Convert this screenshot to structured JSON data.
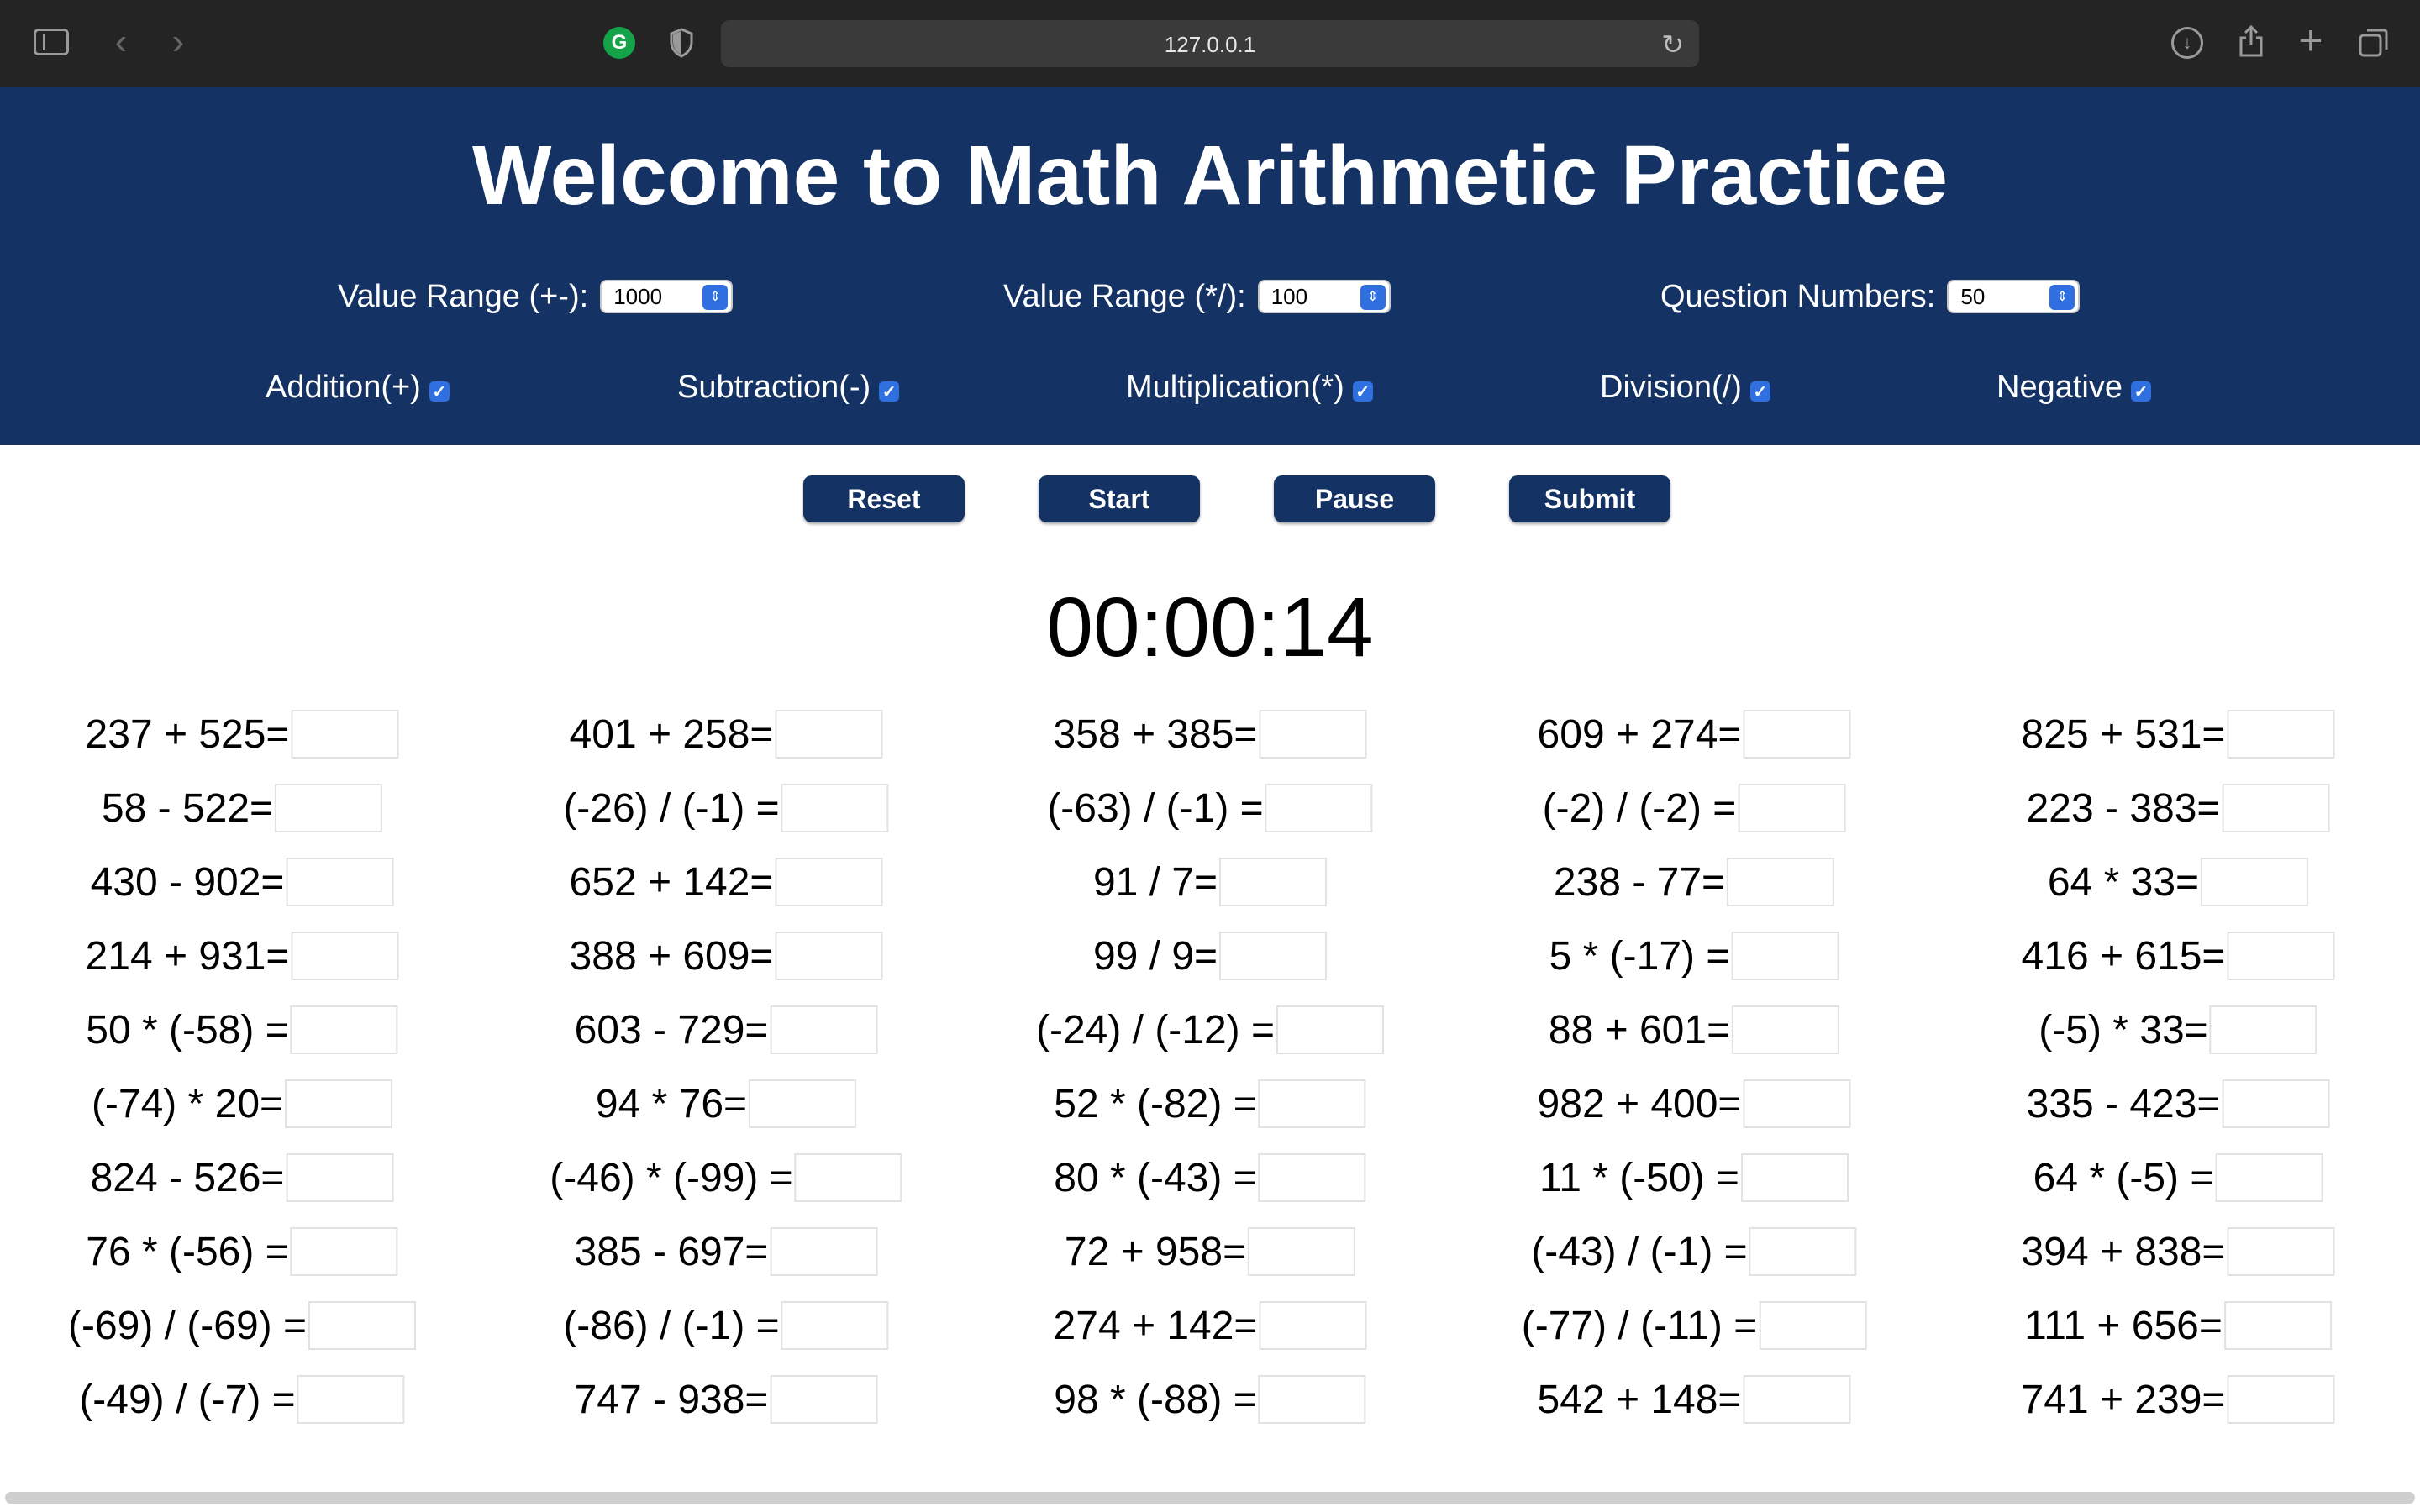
{
  "browser": {
    "url": "127.0.0.1",
    "icons": [
      "sidebar-toggle-icon",
      "back-arrow-icon",
      "forward-arrow-icon",
      "grammarly-icon",
      "privacy-shield-icon",
      "reload-icon",
      "download-icon",
      "share-icon",
      "new-tab-plus-icon",
      "tab-overview-icon"
    ],
    "grammarly_letter": "G"
  },
  "header": {
    "title": "Welcome to Math Arithmetic Practice",
    "range_add_label": "Value Range (+-):",
    "range_add_value": "1000",
    "range_mul_label": "Value Range (*/):",
    "range_mul_value": "100",
    "question_count_label": "Question Numbers:",
    "question_count_value": "50",
    "operations": [
      {
        "label": "Addition(+)",
        "checked": true
      },
      {
        "label": "Subtraction(-)",
        "checked": true
      },
      {
        "label": "Multiplication(*)",
        "checked": true
      },
      {
        "label": "Division(/)",
        "checked": true
      },
      {
        "label": "Negative",
        "checked": true
      }
    ]
  },
  "controls": {
    "reset": "Reset",
    "start": "Start",
    "pause": "Pause",
    "submit": "Submit"
  },
  "timer": "00:00:14",
  "colors": {
    "header_bg": "#143263",
    "button_bg": "#143263",
    "checkbox": "#2f6fe0"
  },
  "questions": [
    [
      "237 + 525=",
      "58 - 522=",
      "430 - 902=",
      "214 + 931=",
      "50 * (-58) =",
      "(-74) * 20=",
      "824 - 526=",
      "76 * (-56) =",
      "(-69) / (-69) =",
      "(-49) / (-7) ="
    ],
    [
      "401 + 258=",
      "(-26) / (-1) =",
      "652 + 142=",
      "388 + 609=",
      "603 - 729=",
      "94 * 76=",
      "(-46) * (-99) =",
      "385 - 697=",
      "(-86) / (-1) =",
      "747 - 938="
    ],
    [
      "358 + 385=",
      "(-63) / (-1) =",
      "91 / 7=",
      "99 / 9=",
      "(-24) / (-12) =",
      "52 * (-82) =",
      "80 * (-43) =",
      "72 + 958=",
      "274 + 142=",
      "98 * (-88) ="
    ],
    [
      "609 + 274=",
      "(-2) / (-2) =",
      "238 - 77=",
      "5 * (-17) =",
      "88 + 601=",
      "982 + 400=",
      "11 * (-50) =",
      "(-43) / (-1) =",
      "(-77) / (-11) =",
      "542 + 148="
    ],
    [
      "825 + 531=",
      "223 - 383=",
      "64 * 33=",
      "416 + 615=",
      "(-5) * 33=",
      "335 - 423=",
      "64 * (-5) =",
      "394 + 838=",
      "111 + 656=",
      "741 + 239="
    ]
  ]
}
